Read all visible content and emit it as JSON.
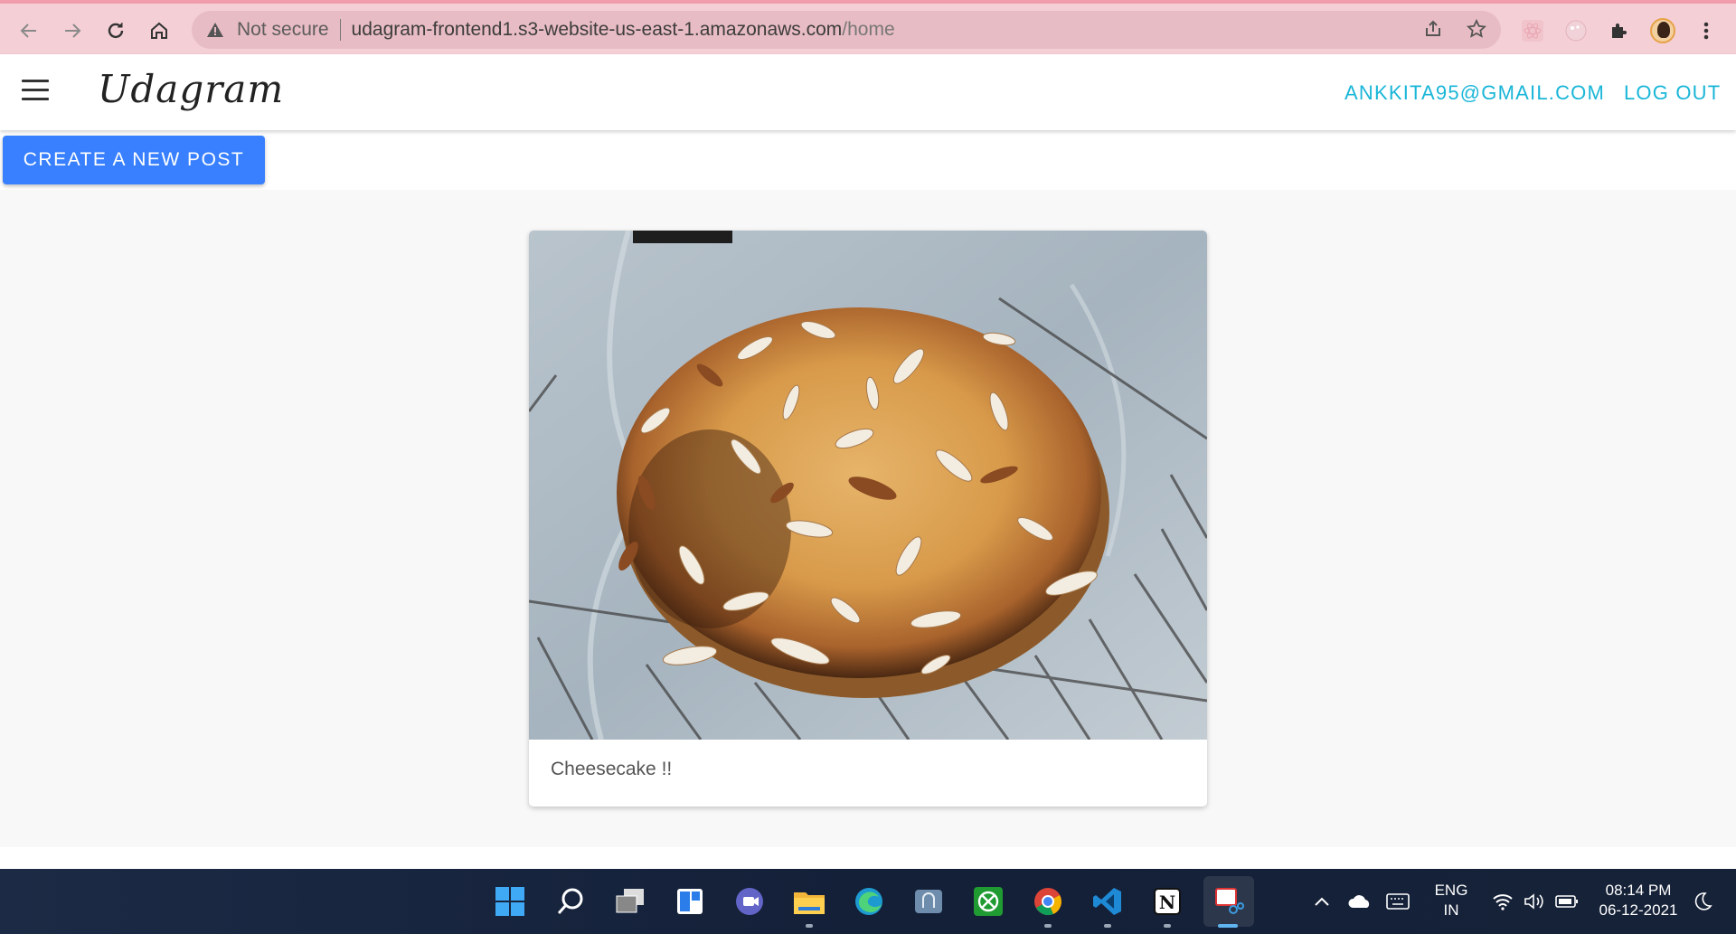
{
  "browser": {
    "address_warning": "Not secure",
    "url_host": "udagram-frontend1.s3-website-us-east-1.amazonaws.com",
    "url_path": "/home"
  },
  "app": {
    "brand": "Udagram",
    "user_email": "ANKKITA95@GMAIL.COM",
    "logout_label": "LOG OUT",
    "create_post_label": "CREATE A NEW POST"
  },
  "feed": {
    "posts": [
      {
        "caption": "Cheesecake !!"
      }
    ]
  },
  "taskbar": {
    "lang_top": "ENG",
    "lang_bottom": "IN",
    "time": "08:14 PM",
    "date": "06-12-2021"
  },
  "colors": {
    "chrome_bg": "#f4cfd6",
    "accent_link": "#1ab6d8",
    "primary_button": "#3880ff",
    "loading_bar": "#e01b22"
  }
}
